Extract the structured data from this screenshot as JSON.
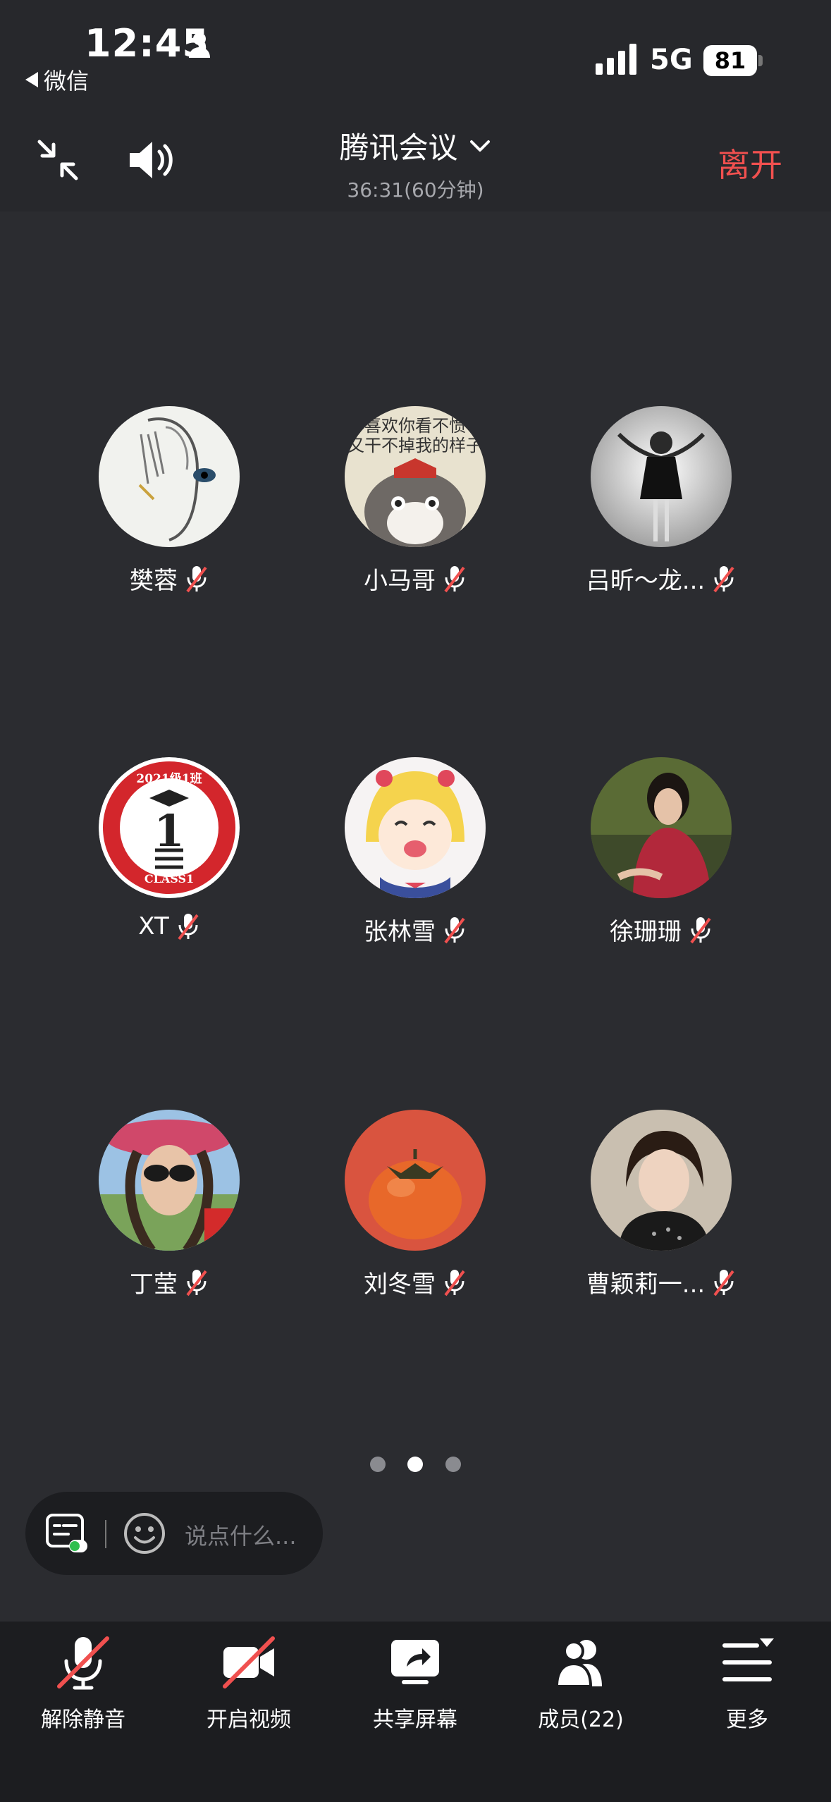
{
  "status_bar": {
    "time": "12:45",
    "back_app": "微信",
    "network": "5G",
    "battery": "81"
  },
  "header": {
    "title": "腾讯会议",
    "subtitle": "36:31(60分钟)",
    "leave_label": "离开"
  },
  "participants": [
    {
      "name": "樊蓉"
    },
    {
      "name": "小马哥"
    },
    {
      "name": "吕昕～龙..."
    },
    {
      "name": "XT"
    },
    {
      "name": "张林雪"
    },
    {
      "name": "徐珊珊"
    },
    {
      "name": "丁莹"
    },
    {
      "name": "刘冬雪"
    },
    {
      "name": "曹颖莉一..."
    }
  ],
  "avatar_images": {
    "p2_text": "喜欢你看不惯又干不掉我的样子",
    "p4_badge_top": "2021级1班",
    "p4_badge_num": "1",
    "p4_badge_bottom": "CLASS1"
  },
  "pagination": {
    "pages": 3,
    "current": 2
  },
  "chat": {
    "placeholder": "说点什么..."
  },
  "toolbar": {
    "unmute": "解除静音",
    "video": "开启视频",
    "share": "共享屏幕",
    "members": "成员(22)",
    "more": "更多"
  },
  "colors": {
    "accent_red": "#f0504f",
    "bg": "#2b2c30",
    "bar": "#1c1d20"
  }
}
